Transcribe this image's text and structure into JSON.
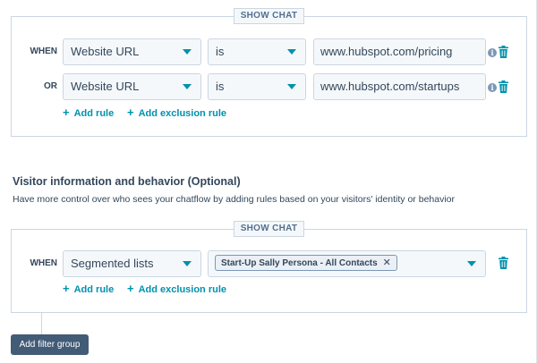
{
  "filter_group_1": {
    "badge": "SHOW CHAT",
    "rows": [
      {
        "connector": "WHEN",
        "property": "Website URL",
        "operator": "is",
        "value": "www.hubspot.com/pricing"
      },
      {
        "connector": "OR",
        "property": "Website URL",
        "operator": "is",
        "value": "www.hubspot.com/startups"
      }
    ],
    "add_rule_label": "Add rule",
    "add_exclusion_label": "Add exclusion rule"
  },
  "visitor_section": {
    "title": "Visitor information and behavior (Optional)",
    "description": "Have more control over who sees your chatflow by adding rules based on your visitors' identity or behavior"
  },
  "filter_group_2": {
    "badge": "SHOW CHAT",
    "row": {
      "connector": "WHEN",
      "property": "Segmented lists",
      "tag": "Start-Up Sally Persona - All Contacts"
    },
    "add_rule_label": "Add rule",
    "add_exclusion_label": "Add exclusion rule"
  },
  "add_filter_group_label": "Add filter group",
  "icons": {
    "info": "info-icon",
    "trash": "trash-icon",
    "caret": "chevron-down-icon",
    "plus": "plus-icon",
    "remove": "close-icon"
  },
  "colors": {
    "accent": "#0091ae",
    "text": "#33475b",
    "border": "#cbd6e2",
    "field_bg": "#f5f8fa",
    "button_bg": "#425b76"
  }
}
